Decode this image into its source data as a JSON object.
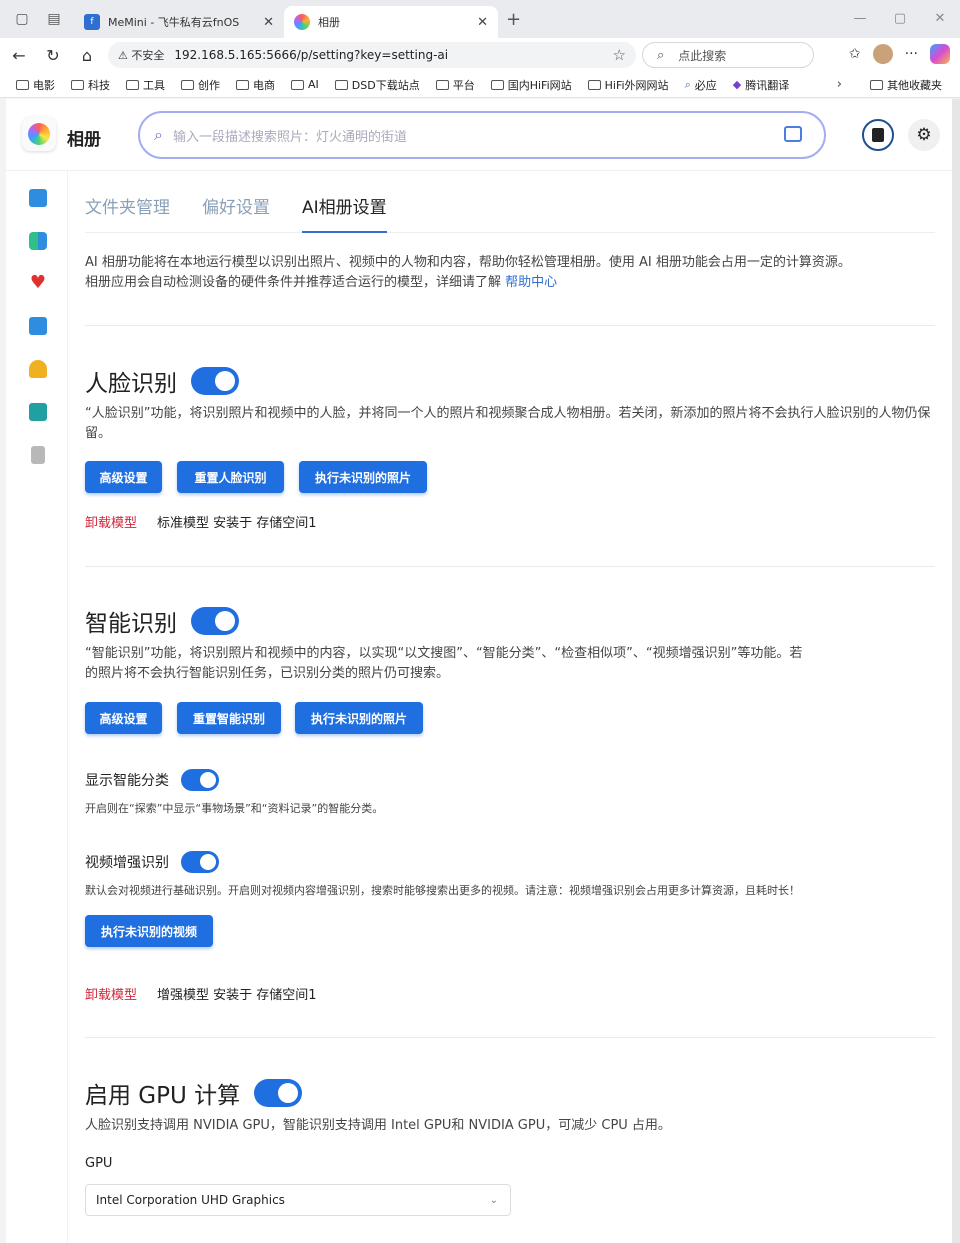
{
  "browser": {
    "tabs": [
      {
        "title": "MeMini - 飞牛私有云fnOS",
        "favicon": "fnos-icon"
      },
      {
        "title": "相册",
        "favicon": "photos-icon"
      }
    ],
    "url_warning": "不安全",
    "url": "192.168.5.165:5666/p/setting?key=setting-ai",
    "search_placeholder": "点此搜索",
    "bookmarks": [
      "电影",
      "科技",
      "工具",
      "创作",
      "电商",
      "AI",
      "DSD下载站点",
      "平台",
      "国内HiFi网站",
      "HiFi外网网站",
      "必应",
      "腾讯翻译"
    ],
    "other_bookmarks": "其他收藏夹"
  },
  "app": {
    "title": "相册",
    "search_placeholder": "输入一段描述搜索照片：灯火通明的街道"
  },
  "settings": {
    "tabs": [
      "文件夹管理",
      "偏好设置",
      "AI相册设置"
    ],
    "active_tab": "AI相册设置",
    "intro_line1": "AI 相册功能将在本地运行模型以识别出照片、视频中的人物和内容，帮助你轻松管理相册。使用 AI 相册功能会占用一定的计算资源。",
    "intro_line2": "相册应用会自动检测设备的硬件条件并推荐适合运行的模型，详细请了解",
    "help_link": "帮助中心",
    "face": {
      "title": "人脸识别",
      "enabled": true,
      "desc": "“人脸识别”功能，将识别照片和视频中的人脸，并将同一个人的照片和视频聚合成人物相册。若关闭，新添加的照片将不会执行人脸识别的人物仍保留。",
      "buttons": [
        "高级设置",
        "重置人脸识别",
        "执行未识别的照片"
      ],
      "unload": "卸载模型",
      "model_info": "标准模型 安装于 存储空间1"
    },
    "smart": {
      "title": "智能识别",
      "enabled": true,
      "desc_line1": "“智能识别”功能，将识别照片和视频中的内容，以实现“以文搜图”、“智能分类”、“检查相似项”、“视频增强识别”等功能。若",
      "desc_line2": "的照片将不会执行智能识别任务，已识别分类的照片仍可搜索。",
      "buttons": [
        "高级设置",
        "重置智能识别",
        "执行未识别的照片"
      ],
      "show_category_title": "显示智能分类",
      "show_category_enabled": true,
      "show_category_desc": "开启则在“探索”中显示“事物场景”和“资料记录”的智能分类。",
      "video_title": "视频增强识别",
      "video_enabled": true,
      "video_desc": "默认会对视频进行基础识别。开启则对视频内容增强识别，搜索时能够搜索出更多的视频。请注意：视频增强识别会占用更多计算资源，且耗时长！",
      "video_button": "执行未识别的视频",
      "unload": "卸载模型",
      "model_info": "增强模型 安装于 存储空间1"
    },
    "gpu": {
      "title": "启用 GPU 计算",
      "enabled": true,
      "desc": "人脸识别支持调用 NVIDIA GPU，智能识别支持调用 Intel GPU和 NVIDIA GPU，可减少 CPU 占用。",
      "label": "GPU",
      "selected": "Intel Corporation UHD Graphics"
    }
  },
  "colors": {
    "accent": "#1f6fe0",
    "danger": "#d0283c",
    "link": "#2f6fd0"
  }
}
